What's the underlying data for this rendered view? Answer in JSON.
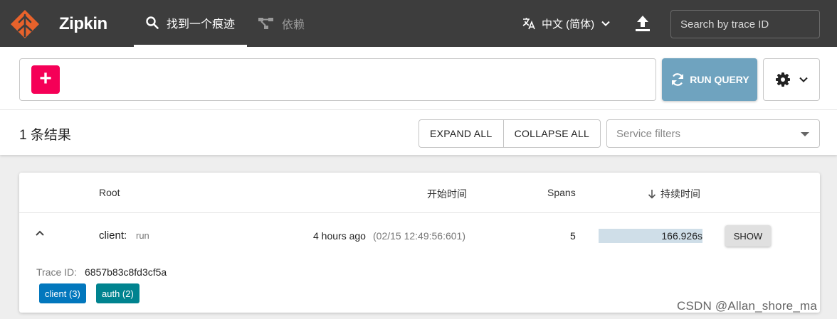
{
  "header": {
    "brand": "Zipkin",
    "tabs": [
      {
        "label": "找到一个痕迹",
        "active": true,
        "icon": "search-icon"
      },
      {
        "label": "依赖",
        "active": false,
        "icon": "dependencies-icon"
      }
    ],
    "language": "中文 (简体)",
    "trace_search_placeholder": "Search by trace ID"
  },
  "query": {
    "add_label": "+",
    "run_label": "RUN QUERY"
  },
  "results": {
    "count_label": "1 条结果",
    "expand_all": "EXPAND ALL",
    "collapse_all": "COLLAPSE ALL",
    "service_filter_placeholder": "Service filters"
  },
  "table": {
    "headers": {
      "root": "Root",
      "start_time": "开始时间",
      "spans": "Spans",
      "duration": "持续时间"
    },
    "rows": [
      {
        "service": "client:",
        "span": "run",
        "time_ago": "4 hours ago",
        "time_abs": "(02/15 12:49:56:601)",
        "spans": "5",
        "duration": "166.926s",
        "duration_fraction": 1.0,
        "show_label": "SHOW",
        "trace_id_label": "Trace ID:",
        "trace_id": "6857b83c8fd3cf5a",
        "badges": [
          {
            "label": "client (3)",
            "color": "#0277bd"
          },
          {
            "label": "auth (2)",
            "color": "#00838f"
          }
        ]
      }
    ]
  },
  "watermark": "CSDN @Allan_shore_ma",
  "colors": {
    "header_bg": "#3d3d3d",
    "brand_orange": "#e8622b",
    "add_button": "#f50057",
    "run_button": "#6fa3bf",
    "duration_bar": "#cfdee8"
  }
}
